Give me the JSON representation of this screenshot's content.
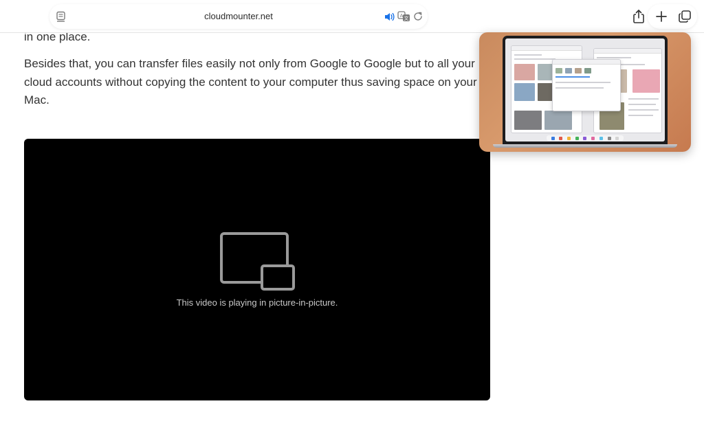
{
  "browser": {
    "url": "cloudmounter.net",
    "icons": {
      "reader": "reader-page-menu-icon",
      "sound": "speaker-playing-icon",
      "translate": "translate-icon",
      "reload": "reload-icon",
      "share": "share-icon",
      "new_tab": "plus-icon",
      "tabs": "tab-overview-icon"
    },
    "accent_color": "#1a73e8"
  },
  "article": {
    "fragment_top": "in one place.",
    "paragraph": "Besides that, you can transfer files easily not only from Google to Google but to all your cloud accounts without copying the content to your computer thus saving space on your Mac."
  },
  "video": {
    "message": "This video is playing in picture-in-picture.",
    "icon": "picture-in-picture-icon"
  },
  "pip_window": {
    "content": "laptop-screen-preview"
  }
}
